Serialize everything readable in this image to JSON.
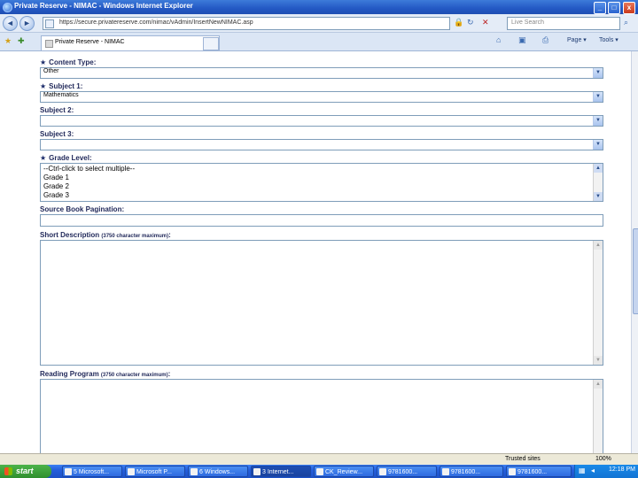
{
  "window": {
    "title": "Private Reserve - NIMAC - Windows Internet Explorer",
    "minimize": "_",
    "maximize": "□",
    "close": "x"
  },
  "browser": {
    "back": "◄",
    "forward": "►",
    "address": "https://secure.privatereserve.com/nimac/vAdmin/InsertNewNIMAC.asp",
    "search_placeholder": "Live Search",
    "tab_label": "Private Reserve - NIMAC",
    "cmd_page": "Page ▾",
    "cmd_tools": "Tools ▾",
    "favorites_icon": "star-icon",
    "add_favorites_icon": "add-favorite-icon"
  },
  "form": {
    "content_type": {
      "label": "Content Type:",
      "value": "Other"
    },
    "subject1": {
      "label": "Subject 1:",
      "value": "Mathematics"
    },
    "subject2": {
      "label": "Subject 2:",
      "value": ""
    },
    "subject3": {
      "label": "Subject 3:",
      "value": ""
    },
    "grade_level": {
      "label": "Grade Level:",
      "options": [
        "--Ctrl-click to select multiple--",
        "Grade 1",
        "Grade 2",
        "Grade 3"
      ]
    },
    "pagination": {
      "label": "Source Book Pagination:",
      "value": ""
    },
    "short_description": {
      "label": "Short Description",
      "note": "(3750 character maximum)",
      "colon": ":"
    },
    "reading_program": {
      "label": "Reading Program",
      "note": "(3750 character maximum)",
      "colon": ":"
    }
  },
  "status": {
    "zone": "Trusted sites",
    "zoom": "100%"
  },
  "taskbar": {
    "start": "start",
    "tasks": [
      "5 Microsoft...",
      "Microsoft P...",
      "6 Windows...",
      "3 Internet...",
      "CK_Review...",
      "9781600...",
      "9781600...",
      "9781600..."
    ],
    "clock": "12:18 PM"
  }
}
